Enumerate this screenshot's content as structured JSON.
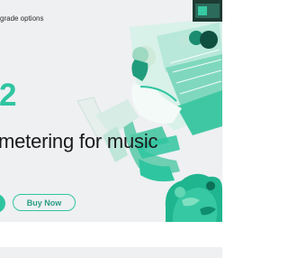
{
  "header": {
    "upgrade_link": "grade options"
  },
  "hero": {
    "version_number": "2",
    "tagline": "metering for music",
    "buy_button": "Buy Now"
  },
  "colors": {
    "accent": "#2fc5a0",
    "hero_background": "#eef0f2",
    "text": "#1a1a1a"
  }
}
